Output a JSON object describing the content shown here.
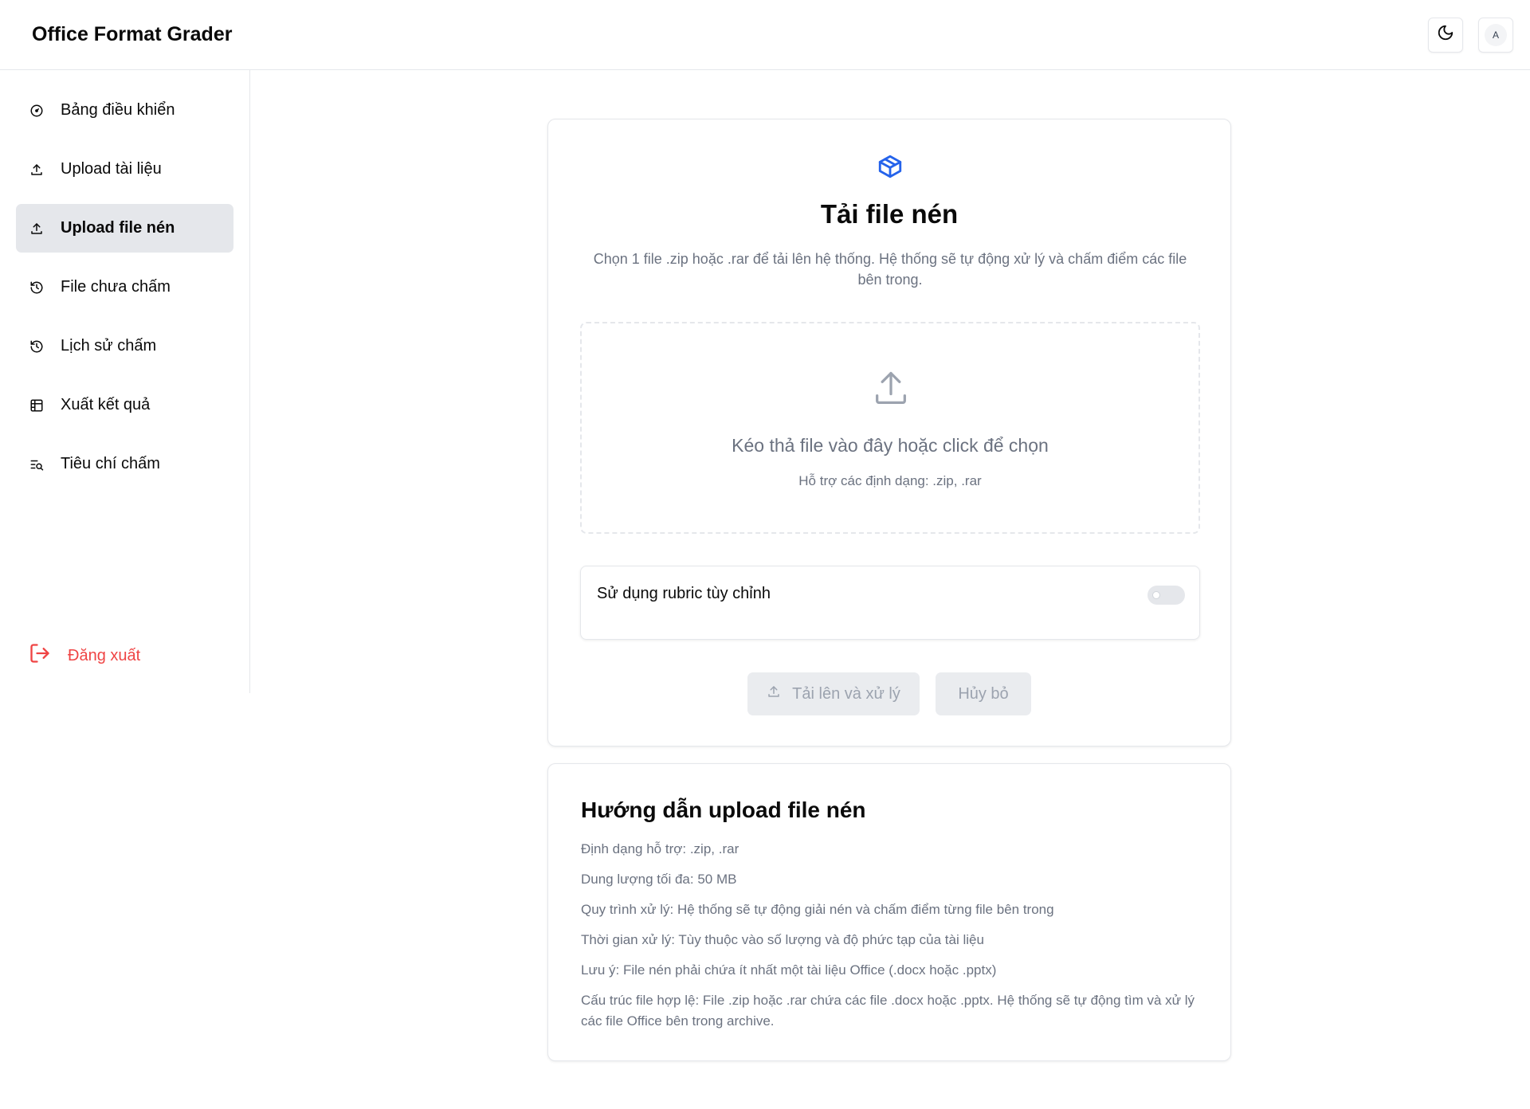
{
  "header": {
    "title": "Office Format Grader",
    "theme_icon": "moon-icon",
    "avatar_initial": "A"
  },
  "sidebar": {
    "items": [
      {
        "label": "Bảng điều khiển",
        "icon": "gauge-icon",
        "active": false
      },
      {
        "label": "Upload tài liệu",
        "icon": "upload-icon",
        "active": false
      },
      {
        "label": "Upload file nén",
        "icon": "upload-icon",
        "active": true
      },
      {
        "label": "File chưa chấm",
        "icon": "history-icon",
        "active": false
      },
      {
        "label": "Lịch sử chấm",
        "icon": "history-icon",
        "active": false
      },
      {
        "label": "Xuất kết quả",
        "icon": "table-icon",
        "active": false
      },
      {
        "label": "Tiêu chí chấm",
        "icon": "list-search-icon",
        "active": false
      }
    ],
    "logout_label": "Đăng xuất"
  },
  "upload": {
    "icon": "package-icon",
    "title": "Tải file nén",
    "description": "Chọn 1 file .zip hoặc .rar để tải lên hệ thống. Hệ thống sẽ tự động xử lý và chấm điểm các file bên trong.",
    "dropzone_text": "Kéo thả file vào đây hoặc click để chọn",
    "dropzone_subtext": "Hỗ trợ các định dạng: .zip, .rar",
    "rubric_label": "Sử dụng rubric tùy chỉnh",
    "rubric_enabled": false,
    "submit_label": "Tải lên và xử lý",
    "cancel_label": "Hủy bỏ"
  },
  "guide": {
    "title": "Hướng dẫn upload file nén",
    "items": [
      "Định dạng hỗ trợ: .zip, .rar",
      "Dung lượng tối đa: 50 MB",
      "Quy trình xử lý: Hệ thống sẽ tự động giải nén và chấm điểm từng file bên trong",
      "Thời gian xử lý: Tùy thuộc vào số lượng và độ phức tạp của tài liệu",
      "Lưu ý: File nén phải chứa ít nhất một tài liệu Office (.docx hoặc .pptx)",
      "Cấu trúc file hợp lệ: File .zip hoặc .rar chứa các file .docx hoặc .pptx. Hệ thống sẽ tự động tìm và xử lý các file Office bên trong archive."
    ]
  },
  "colors": {
    "accent": "#2563eb",
    "danger": "#ef4444",
    "muted_text": "#6b7280",
    "border": "#e5e7eb"
  }
}
